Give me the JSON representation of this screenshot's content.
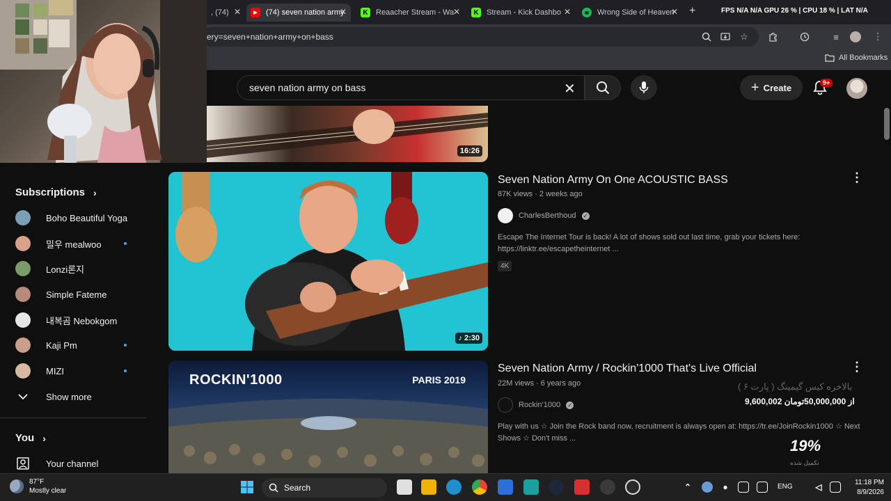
{
  "browser": {
    "tabs": [
      {
        "label": ", (74)",
        "active": false
      },
      {
        "label": "(74) seven nation army",
        "active": true
      },
      {
        "label": "Reaacher Stream - Wa",
        "active": false
      },
      {
        "label": "Stream - Kick Dashbo",
        "active": false
      },
      {
        "label": "Wrong Side of Heaven",
        "active": false
      }
    ],
    "perf_overlay": "FPS  N/A  N/A  GPU 26 %  |  CPU  18 %  |  LAT  N/A",
    "url": "ery=seven+nation+army+on+bass",
    "all_bookmarks": "All Bookmarks"
  },
  "youtube": {
    "search": {
      "query": "seven nation army on bass"
    },
    "create_label": "Create",
    "notifications_badge": "9+"
  },
  "sidebar": {
    "subscriptions_label": "Subscriptions",
    "items": [
      {
        "label": "Boho Beautiful Yoga",
        "new": false,
        "color": "#7aa0b8"
      },
      {
        "label": "밀우 mealwoo",
        "new": true,
        "color": "#d9a08a"
      },
      {
        "label": "Lonzi론지",
        "new": false,
        "color": "#7b9b6a"
      },
      {
        "label": "Simple Fateme",
        "new": false,
        "color": "#b88a7a"
      },
      {
        "label": "내복곰 Nebokgom",
        "new": false,
        "color": "#e6e6e6"
      },
      {
        "label": "Kaji Pm",
        "new": true,
        "color": "#c8a08a"
      },
      {
        "label": "MIZI",
        "new": true,
        "color": "#d8b8a0"
      }
    ],
    "show_more": "Show more",
    "you_label": "You",
    "your_channel": "Your channel"
  },
  "results": [
    {
      "duration": "16:26"
    },
    {
      "title": "Seven Nation Army On One ACOUSTIC BASS",
      "views": "87K views",
      "age": "2 weeks ago",
      "channel": "CharlesBerthoud",
      "description": "Escape The Internet Tour is back! A lot of shows sold out last time, grab your tickets here: https://linktr.ee/escapetheinternet ...",
      "badge": "4K",
      "duration": "2:30"
    },
    {
      "title": "Seven Nation Army / Rockin'1000 That's Live Official",
      "views": "22M views",
      "age": "6 years ago",
      "channel": "Rockin'1000",
      "description": "Play with us ☆ Join the Rock band now, recruitment is always open at: https://tr.ee/JoinRockin1000 ☆ Next Shows ☆ Don't miss ...",
      "thumb_left": "ROCKIN'1000",
      "thumb_right": "PARIS 2019"
    }
  ],
  "stream_overlay": {
    "persian_title": "بالاخره کیس گیمینگ ( پارت ۶ )",
    "price": "9,600,002 از 50,000,000تومان",
    "percent": "19%",
    "percent_sub": "تکمیل شده"
  },
  "taskbar": {
    "weather_temp": "87°F",
    "weather_desc": "Mostly clear",
    "search_label": "Search",
    "lang": "ENG",
    "time": "11:18 PM",
    "date": "8/9/2026"
  }
}
